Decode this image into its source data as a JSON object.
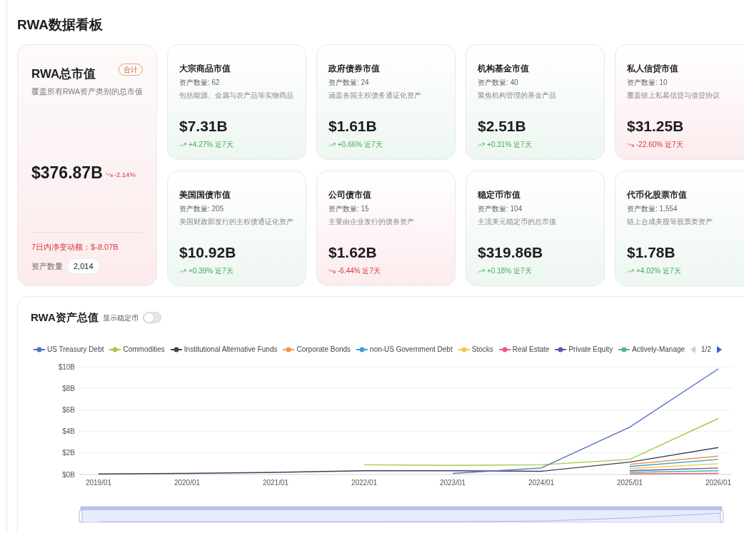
{
  "page_title": "RWA数据看板",
  "total": {
    "title": "RWA总市值",
    "badge": "合计",
    "subtitle": "覆盖所有RWA资产类别的总市值",
    "value": "$376.87B",
    "change": "-2.14%",
    "negative": true,
    "net_change": "7日内净变动额：$-8.07B",
    "count_label": "资产数量",
    "count": "2,014"
  },
  "categories": [
    {
      "title": "大宗商品市值",
      "count": "资产数量: 62",
      "description": "包括能源、金属与农产品等实物商品",
      "value": "$7.31B",
      "change": "+4.27%",
      "period": "近7天",
      "negative": false
    },
    {
      "title": "政府债券市值",
      "count": "资产数量: 24",
      "description": "涵盖各国主权债务通证化资产",
      "value": "$1.61B",
      "change": "+0.66%",
      "period": "近7天",
      "negative": false
    },
    {
      "title": "机构基金市值",
      "count": "资产数量: 40",
      "description": "聚焦机构管理的基金产品",
      "value": "$2.51B",
      "change": "+0.31%",
      "period": "近7天",
      "negative": false
    },
    {
      "title": "私人信贷市值",
      "count": "资产数量: 10",
      "description": "覆盖链上私募信贷与借贷协议",
      "value": "$31.25B",
      "change": "-22.60%",
      "period": "近7天",
      "negative": true
    },
    {
      "title": "美国国债市值",
      "count": "资产数量: 205",
      "description": "美国财政部发行的主权债通证化资产",
      "value": "$10.92B",
      "change": "+0.39%",
      "period": "近7天",
      "negative": false
    },
    {
      "title": "公司债市值",
      "count": "资产数量: 15",
      "description": "主要由企业发行的债券资产",
      "value": "$1.62B",
      "change": "-6.44%",
      "period": "近7天",
      "negative": true
    },
    {
      "title": "稳定币市值",
      "count": "资产数量: 104",
      "description": "主流美元稳定币的总市值",
      "value": "$319.86B",
      "change": "+0.18%",
      "period": "近7天",
      "negative": false
    },
    {
      "title": "代币化股票市值",
      "count": "资产数量: 1,554",
      "description": "链上合成美股等股票类资产",
      "value": "$1.78B",
      "change": "+4.02%",
      "period": "近7天",
      "negative": false
    }
  ],
  "chart_panel": {
    "title": "RWA资产总值",
    "toggle": {
      "label": "显示稳定币",
      "on": false
    },
    "legend_pager": {
      "page": "1/2",
      "prev_disabled": true,
      "next_disabled": false
    },
    "chart_data": {
      "type": "line",
      "ylim": [
        0,
        10
      ],
      "grid": true,
      "legend": true,
      "yticks": [
        {
          "value": 0,
          "label": "$0B"
        },
        {
          "value": 2,
          "label": "$2B"
        },
        {
          "value": 4,
          "label": "$4B"
        },
        {
          "value": 6,
          "label": "$6B"
        },
        {
          "value": 8,
          "label": "$8B"
        },
        {
          "value": 10,
          "label": "$10B"
        }
      ],
      "categories": [
        "2019/01",
        "2020/01",
        "2021/01",
        "2022/01",
        "2023/01",
        "2024/01",
        "2025/01",
        "2026/01"
      ],
      "series": [
        {
          "name": "US Treasury Debt",
          "color": "#5470c6",
          "values": [
            null,
            null,
            null,
            null,
            0.1,
            0.6,
            4.4,
            9.8
          ]
        },
        {
          "name": "Commodities",
          "color": "#a5c844",
          "values": [
            null,
            null,
            null,
            0.9,
            0.85,
            0.9,
            1.4,
            5.2
          ]
        },
        {
          "name": "Institutional Alternative Funds",
          "color": "#3d3f5c",
          "values": [
            0.05,
            0.1,
            0.2,
            0.35,
            0.35,
            0.3,
            1.15,
            2.5
          ]
        },
        {
          "name": "Corporate Bonds",
          "color": "#f0954a",
          "values": [
            null,
            null,
            null,
            null,
            null,
            null,
            0.95,
            1.7
          ]
        },
        {
          "name": "non-US Government Debt",
          "color": "#3ba0d8",
          "values": [
            null,
            null,
            null,
            null,
            null,
            null,
            0.75,
            1.4
          ]
        },
        {
          "name": "Stocks",
          "color": "#f5c842",
          "values": [
            null,
            null,
            null,
            null,
            null,
            null,
            0.55,
            1
          ]
        },
        {
          "name": "Real Estate",
          "color": "#e45c84",
          "values": [
            null,
            null,
            null,
            null,
            null,
            null,
            0.05,
            0.1
          ]
        },
        {
          "name": "Private Equity",
          "color": "#6c4fb0",
          "values": [
            null,
            null,
            null,
            null,
            null,
            null,
            0.35,
            0.6
          ]
        },
        {
          "name": "Actively-Manage",
          "color": "#4cb88a",
          "values": [
            null,
            null,
            null,
            null,
            null,
            null,
            0.2,
            0.35
          ]
        }
      ]
    }
  }
}
